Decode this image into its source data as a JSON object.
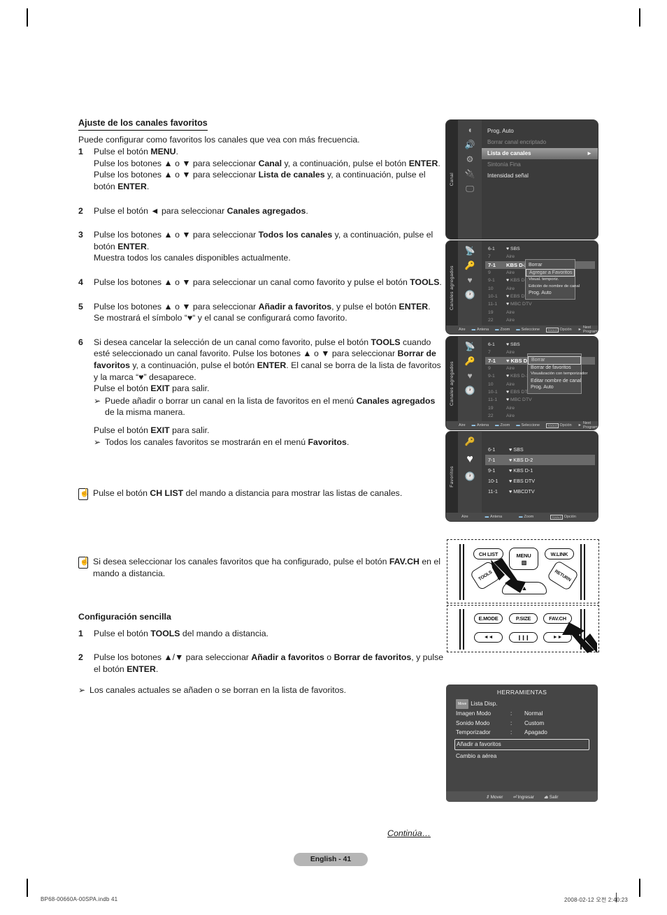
{
  "document": {
    "footer_left": "BP68-00660A-00SPA.indb   41",
    "footer_right": "2008-02-12   오전 2:40:23",
    "continued": "Continúa…",
    "page_label": "English - 41"
  },
  "section1": {
    "heading": "Ajuste de los canales favoritos",
    "lead": "Puede configurar como favoritos los canales que vea con más frecuencia.",
    "steps": [
      {
        "num": "1",
        "lines": [
          "Pulse el botón MENU.",
          "Pulse los botones ▲ o ▼ para seleccionar Canal y, a continuación, pulse el botón ENTER.",
          "Pulse los botones ▲ o ▼ para seleccionar Lista de canales y, a continuación, pulse el botón ENTER."
        ]
      },
      {
        "num": "2",
        "lines": [
          "Pulse el botón ◄ para seleccionar Canales agregados."
        ]
      },
      {
        "num": "3",
        "lines": [
          "Pulse los botones ▲ o ▼ para seleccionar Todos los canales y, a continuación, pulse el botón ENTER.",
          "Muestra todos los canales disponibles actualmente."
        ]
      },
      {
        "num": "4",
        "lines": [
          "Pulse los botones ▲ o ▼ para seleccionar un canal como favorito y pulse el botón TOOLS."
        ]
      },
      {
        "num": "5",
        "lines": [
          "Pulse los botones ▲ o ▼ para seleccionar Añadir a favoritos, y pulse el botón ENTER.",
          "Se mostrará el símbolo \"♥\" y el canal se configurará como favorito."
        ]
      },
      {
        "num": "6",
        "lines": [
          "Si desea cancelar la selección de un canal como favorito, pulse el botón TOOLS cuando esté seleccionado un canal favorito. Pulse los botones ▲ o ▼ para seleccionar Borrar de favoritos y, a continuación, pulse el botón ENTER. El canal se borra de la lista de favoritos y la marca \"♥\" desaparece.",
          "Pulse el botón EXIT para salir."
        ],
        "note": "Puede añadir o borrar un canal en la lista de favoritos en el menú Canales agregados de la misma manera.",
        "tail": "Pulse el botón EXIT para salir.",
        "tail_note": "Todos los canales favoritos se mostrarán en el menú Favoritos."
      }
    ]
  },
  "notes": [
    {
      "icon": "remote-hand-icon",
      "text": "Pulse el botón CH LIST del mando a distancia para mostrar las listas de canales."
    },
    {
      "icon": "remote-hand-icon",
      "text": "Si desea seleccionar los canales favoritos que ha configurado, pulse el botón FAV.CH en el mando a distancia."
    }
  ],
  "section2": {
    "heading": "Configuración sencilla",
    "steps": [
      {
        "num": "1",
        "lines": [
          "Pulse el botón TOOLS del mando a distancia."
        ]
      },
      {
        "num": "2",
        "lines": [
          "Pulse los botones ▲/▼ para seleccionar Añadir a favoritos o Borrar de favoritos, y pulse el botón ENTER."
        ]
      }
    ],
    "note": "Los canales actuales se añaden o se borran en la lista de favoritos."
  },
  "osd_channel_menu": {
    "rail_label": "Canal",
    "icons": [
      "picture-icon",
      "sound-icon",
      "setup-icon",
      "input-icon",
      "channel-icon"
    ],
    "items": [
      {
        "label": "Prog. Auto",
        "state": "normal"
      },
      {
        "label": "Borrar canal encriptado",
        "state": "dim"
      },
      {
        "label": "Lista de canales",
        "state": "selected",
        "arrow": "►"
      },
      {
        "label": "Sintonía Fina",
        "state": "dim"
      },
      {
        "label": "Intensidad señal",
        "state": "normal"
      }
    ]
  },
  "osd_added_channels_1": {
    "rail_label": "Canales agregados",
    "rows": [
      {
        "no": "6-1",
        "name": "SBS",
        "heart": true,
        "dim": false
      },
      {
        "no": "7",
        "name": "Aire",
        "heart": false,
        "dim": true
      },
      {
        "no": "7-1",
        "name": "KBS D-2",
        "heart": false,
        "dim": false,
        "highlight": true
      },
      {
        "no": "9",
        "name": "Aire",
        "heart": false,
        "dim": true
      },
      {
        "no": "9-1",
        "name": "KBS D-1",
        "heart": true,
        "dim": true
      },
      {
        "no": "10",
        "name": "Aire",
        "heart": false,
        "dim": true
      },
      {
        "no": "10-1",
        "name": "EBS DTV",
        "heart": true,
        "dim": true
      },
      {
        "no": "11-1",
        "name": "MBC DTV",
        "heart": true,
        "dim": true
      },
      {
        "no": "19",
        "name": "Aire",
        "heart": false,
        "dim": true
      },
      {
        "no": "22",
        "name": "Aire",
        "heart": false,
        "dim": true
      }
    ],
    "context_menu": [
      {
        "label": "Borrar",
        "selected": false,
        "big": true
      },
      {
        "label": "Agregar a Favoritos",
        "selected": true,
        "big": true
      },
      {
        "label": "Visual. temporiz.",
        "selected": false,
        "big": false
      },
      {
        "label": "Edición de nombre de canal",
        "selected": false,
        "big": false
      },
      {
        "label": "Prog. Auto",
        "selected": false,
        "big": true
      }
    ],
    "status": {
      "source": "Aire",
      "keys": [
        "Antena",
        "Zoom",
        "Seleccione"
      ],
      "tools_key": "TOOLS",
      "tools_label": "Opción",
      "next": "Next Program"
    }
  },
  "osd_added_channels_2": {
    "rail_label": "Canales agregados",
    "rows": [
      {
        "no": "6-1",
        "name": "SBS",
        "heart": true,
        "dim": false
      },
      {
        "no": "7",
        "name": "Aire",
        "heart": false,
        "dim": true
      },
      {
        "no": "7-1",
        "name": "KBS D-2",
        "heart": true,
        "dim": false,
        "highlight": true
      },
      {
        "no": "9",
        "name": "Aire",
        "heart": false,
        "dim": true
      },
      {
        "no": "9-1",
        "name": "KBS D-1",
        "heart": true,
        "dim": true
      },
      {
        "no": "10",
        "name": "Aire",
        "heart": false,
        "dim": true
      },
      {
        "no": "10-1",
        "name": "EBS DTV",
        "heart": true,
        "dim": true
      },
      {
        "no": "11-1",
        "name": "MBC DTV",
        "heart": true,
        "dim": true
      },
      {
        "no": "19",
        "name": "Aire",
        "heart": false,
        "dim": true
      },
      {
        "no": "22",
        "name": "Aire",
        "heart": false,
        "dim": true
      }
    ],
    "context_menu": [
      {
        "label": "Borrar",
        "selected": true,
        "big": true
      },
      {
        "label": "Borrar de favoritos",
        "selected": false,
        "big": true
      },
      {
        "label": "Visualización con temporizador",
        "selected": false,
        "big": false
      },
      {
        "label": "Editar nombre de canal",
        "selected": false,
        "big": true
      },
      {
        "label": "Prog. Auto",
        "selected": false,
        "big": true
      }
    ],
    "status": {
      "source": "Aire",
      "keys": [
        "Antena",
        "Zoom",
        "Seleccione"
      ],
      "tools_key": "TOOLS",
      "tools_label": "Opción",
      "next": "Next Program"
    }
  },
  "osd_favorites": {
    "rail_label": "Favoritos",
    "rows": [
      {
        "no": "6-1",
        "name": "SBS",
        "heart": true,
        "highlight": false
      },
      {
        "no": "7-1",
        "name": "KBS D-2",
        "heart": true,
        "highlight": true
      },
      {
        "no": "9-1",
        "name": "KBS D-1",
        "heart": true,
        "highlight": false
      },
      {
        "no": "10-1",
        "name": "EBS DTV",
        "heart": true,
        "highlight": false
      },
      {
        "no": "11-1",
        "name": "MBCDTV",
        "heart": true,
        "highlight": false
      }
    ],
    "status": {
      "source": "Aire",
      "keys": [
        "Antena",
        "Zoom"
      ],
      "tools_key": "TOOLS",
      "tools_label": "Opción"
    }
  },
  "remote_1": {
    "buttons": [
      "CH LIST",
      "MENU",
      "W.LINK",
      "TOOLS",
      "RETURN"
    ],
    "pointer_target": "CH LIST"
  },
  "remote_2": {
    "buttons": [
      "E.MODE",
      "P.SIZE",
      "FAV.CH",
      "◄◄",
      "❙❙❙",
      "►►"
    ],
    "pointer_target": "FAV.CH"
  },
  "tools_menu": {
    "title": "HERRAMIENTAS",
    "badge": "Move",
    "first_item": "Lista Disp.",
    "rows": [
      {
        "label": "Imagen Modo",
        "colon": ":",
        "value": "Normal"
      },
      {
        "label": "Sonido Modo",
        "colon": ":",
        "value": "Custom"
      },
      {
        "label": "Temporizador",
        "colon": ":",
        "value": "Apagado"
      }
    ],
    "selected_item": "Añadir a favoritos",
    "plain_item": "Cambio a aérea",
    "footer": [
      {
        "icon": "updown-icon",
        "label": "Mover"
      },
      {
        "icon": "enter-icon",
        "label": "Ingresar"
      },
      {
        "icon": "exit-icon",
        "label": "Salir"
      }
    ]
  }
}
